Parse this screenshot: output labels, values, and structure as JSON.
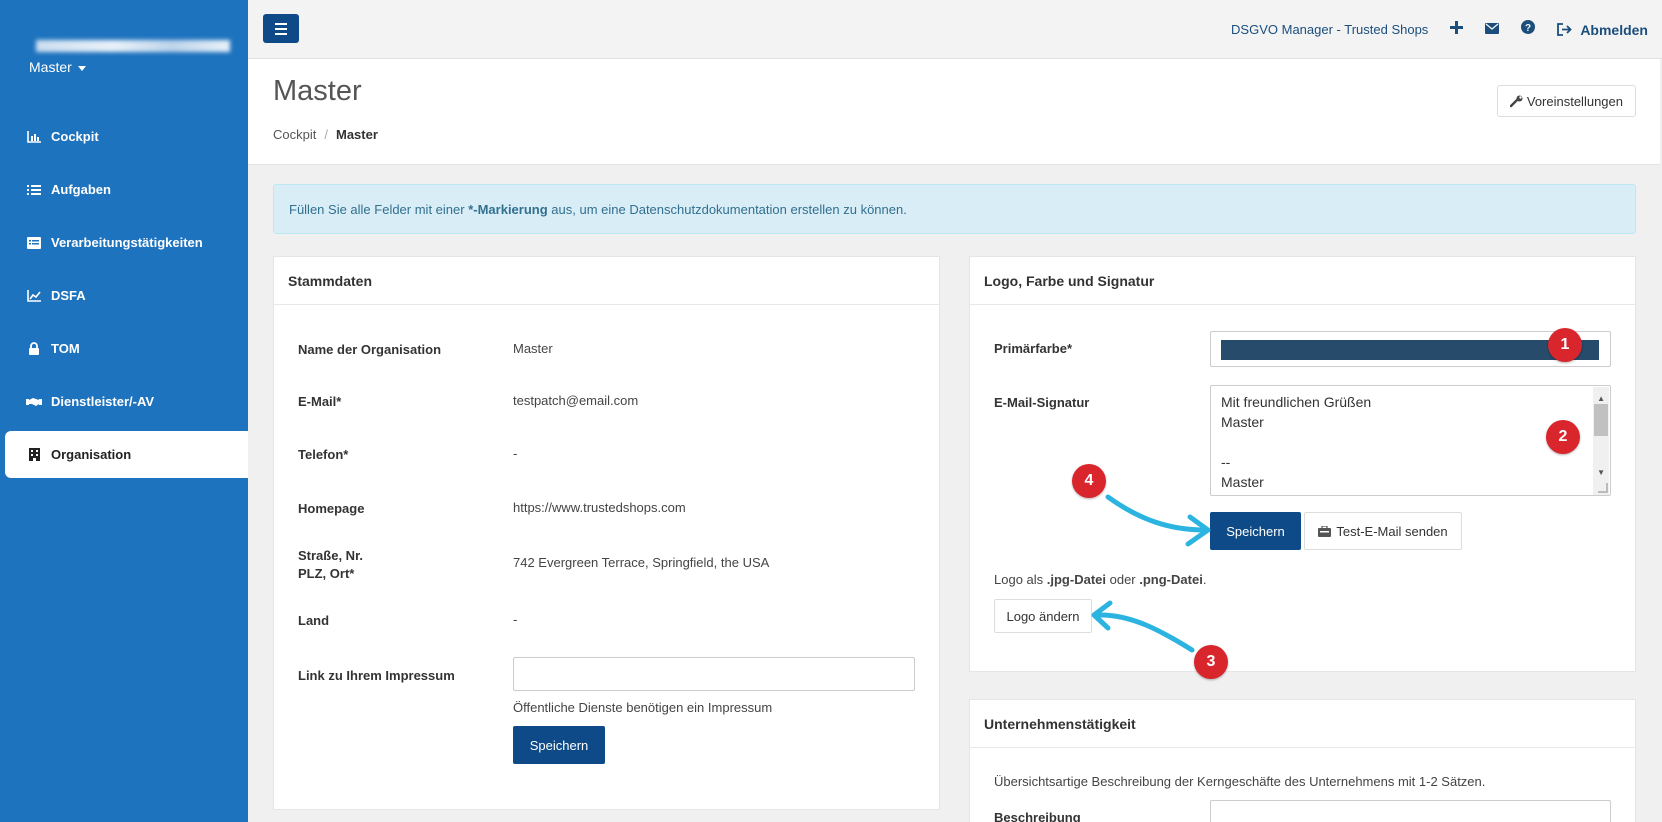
{
  "sidebar": {
    "org_selector": "Master",
    "items": [
      {
        "label": "Cockpit",
        "icon": "chart-icon"
      },
      {
        "label": "Aufgaben",
        "icon": "tasks-icon"
      },
      {
        "label": "Verarbeitungstätigkeiten",
        "icon": "list-icon"
      },
      {
        "label": "DSFA",
        "icon": "area-chart-icon"
      },
      {
        "label": "TOM",
        "icon": "lock-icon"
      },
      {
        "label": "Dienstleister/-AV",
        "icon": "handshake-icon"
      },
      {
        "label": "Organisation",
        "icon": "building-icon"
      }
    ]
  },
  "topbar": {
    "product_link": "DSGVO Manager - Trusted Shops",
    "logout_label": "Abmelden"
  },
  "header": {
    "title": "Master",
    "breadcrumb_root": "Cockpit",
    "breadcrumb_current": "Master",
    "presets_label": "Voreinstellungen"
  },
  "alert": {
    "prefix": "Füllen Sie alle Felder mit einer ",
    "bold": "*-Markierung",
    "suffix": " aus, um eine Datenschutzdokumentation erstellen zu können."
  },
  "stammdaten": {
    "title": "Stammdaten",
    "fields": [
      {
        "label": "Name der Organisation",
        "value": "Master"
      },
      {
        "label": "E-Mail*",
        "value": "testpatch@email.com"
      },
      {
        "label": "Telefon*",
        "value": "-"
      },
      {
        "label": "Homepage",
        "value": "https://www.trustedshops.com"
      },
      {
        "label_line1": "Straße, Nr.",
        "label_line2": "PLZ, Ort*",
        "value": "742 Evergreen Terrace, Springfield, the USA"
      },
      {
        "label": "Land",
        "value": "-"
      },
      {
        "label": "Link zu Ihrem Impressum",
        "value": ""
      }
    ],
    "impressum_help": "Öffentliche Dienste benötigen ein Impressum",
    "save_label": "Speichern"
  },
  "logo_panel": {
    "title": "Logo, Farbe und Signatur",
    "primary_color_label": "Primärfarbe*",
    "primary_color": "#264b6b",
    "signature_label": "E-Mail-Signatur",
    "signature_lines": [
      "Mit freundlichen Grüßen",
      "Master",
      "",
      "--",
      "Master"
    ],
    "save_label": "Speichern",
    "test_mail_label": "Test-E-Mail senden",
    "logo_hint_prefix": "Logo als ",
    "logo_hint_jpg": ".jpg-Datei",
    "logo_hint_mid": " oder ",
    "logo_hint_png": ".png-Datei",
    "logo_hint_end": ".",
    "change_logo_label": "Logo ändern"
  },
  "business_panel": {
    "title": "Unternehmenstätigkeit",
    "description": "Übersichtsartige Beschreibung der Kerngeschäfte des Unternehmens mit 1-2 Sätzen.",
    "field_label": "Beschreibung"
  },
  "annotations": [
    "1",
    "2",
    "3",
    "4"
  ],
  "colors": {
    "sidebar": "#1e73be",
    "primary_button": "#0d4a87",
    "badge": "#d9252c",
    "arrow": "#2cb4e0"
  }
}
